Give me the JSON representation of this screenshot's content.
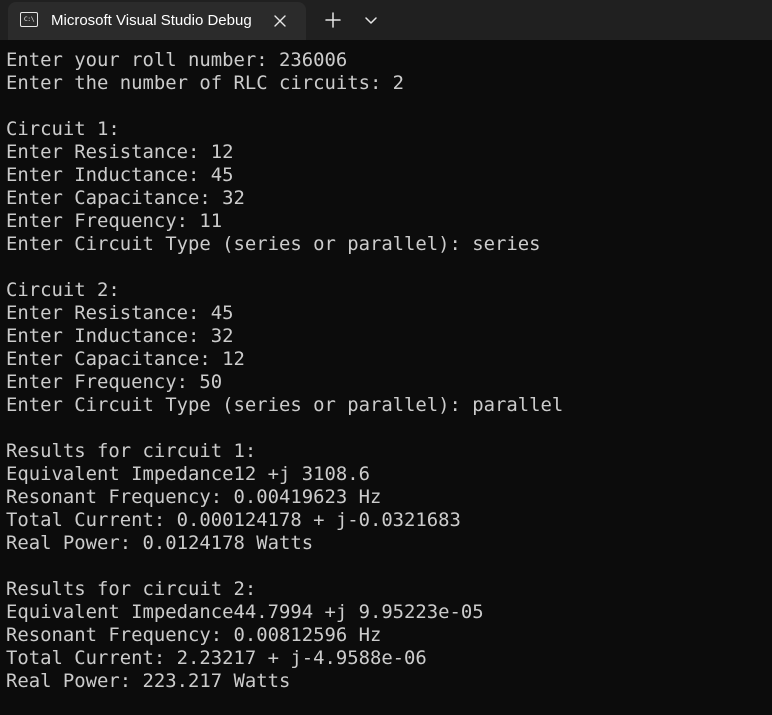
{
  "tab": {
    "icon_name": "terminal-icon",
    "icon_text": "C:\\",
    "title": "Microsoft Visual Studio Debug"
  },
  "icons": {
    "close": "close-icon",
    "new_tab": "plus-icon",
    "dropdown": "chevron-down-icon"
  },
  "console": {
    "lines": [
      "Enter your roll number: 236006",
      "Enter the number of RLC circuits: 2",
      "",
      "Circuit 1:",
      "Enter Resistance: 12",
      "Enter Inductance: 45",
      "Enter Capacitance: 32",
      "Enter Frequency: 11",
      "Enter Circuit Type (series or parallel): series",
      "",
      "Circuit 2:",
      "Enter Resistance: 45",
      "Enter Inductance: 32",
      "Enter Capacitance: 12",
      "Enter Frequency: 50",
      "Enter Circuit Type (series or parallel): parallel",
      "",
      "Results for circuit 1:",
      "Equivalent Impedance12 +j 3108.6",
      "Resonant Frequency: 0.00419623 Hz",
      "Total Current: 0.000124178 + j-0.0321683",
      "Real Power: 0.0124178 Watts",
      "",
      "Results for circuit 2:",
      "Equivalent Impedance44.7994 +j 9.95223e-05",
      "Resonant Frequency: 0.00812596 Hz",
      "Total Current: 2.23217 + j-4.9588e-06",
      "Real Power: 223.217 Watts"
    ]
  },
  "colors": {
    "background": "#0c0c0c",
    "tabbar": "#202020",
    "active_tab": "#2b2b2b",
    "text": "#cccccc"
  }
}
